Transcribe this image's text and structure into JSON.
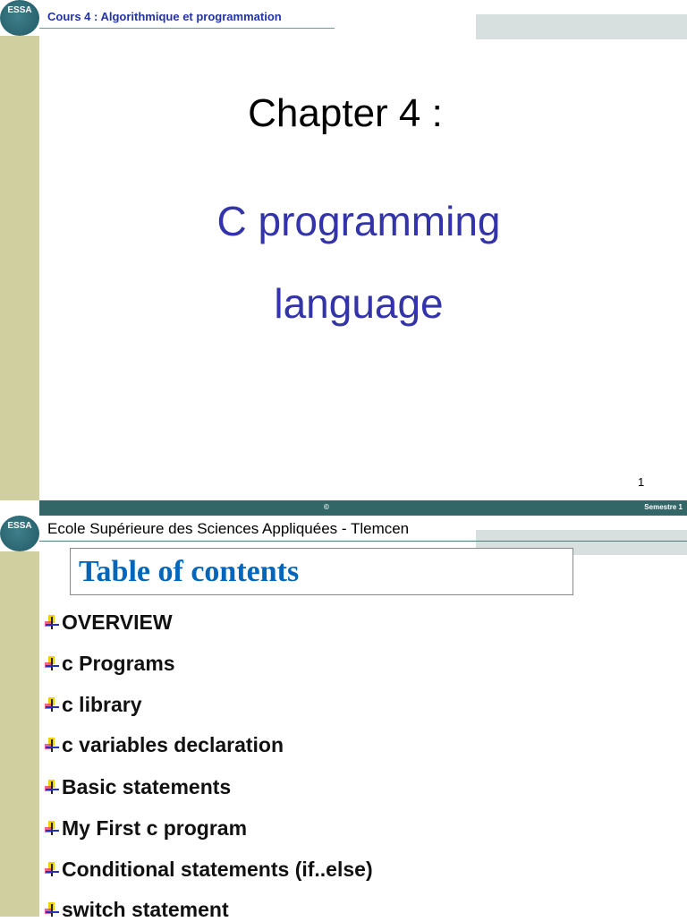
{
  "slide1": {
    "logo_text": "ESSA",
    "header": "Cours 4 : Algorithmique et programmation",
    "title": "Chapter 4 :",
    "subtitle_line1": "C programming",
    "subtitle_line2": "language",
    "page_number": "1",
    "footer_center": "©",
    "footer_right": "Semestre 1"
  },
  "slide2": {
    "logo_text": "ESSA",
    "header": "Ecole Supérieure des Sciences Appliquées  - Tlemcen",
    "title": "Table of contents",
    "items": [
      " OVERVIEW",
      "c Programs",
      "c library",
      "c variables declaration",
      "Basic statements",
      "My First c program",
      "Conditional statements (if..else)",
      "switch statement"
    ]
  },
  "colors": {
    "sidebar": "#cfcfa0",
    "footer": "#336666",
    "accent_blue": "#3333aa",
    "title_blue": "#0066bb"
  }
}
